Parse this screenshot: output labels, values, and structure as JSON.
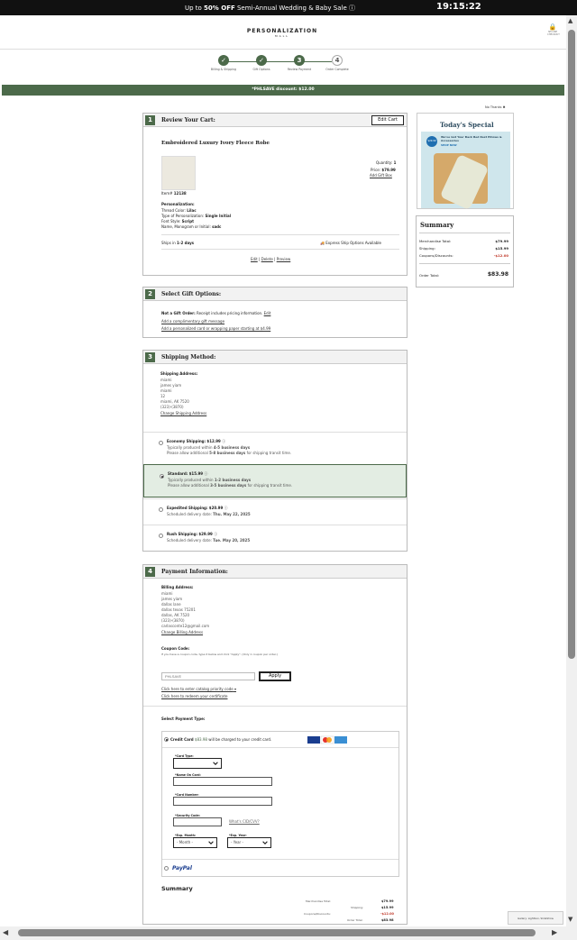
{
  "topbar": {
    "promo_prefix": "Up to ",
    "promo_bold": "50% OFF",
    "promo_suffix": " Semi-Annual Wedding & Baby Sale",
    "clock": "19:15:22"
  },
  "header": {
    "logo_main": "PERSONALIZATION",
    "logo_sub": "MALL",
    "secure_label": "SECURE CHECKOUT"
  },
  "steps": [
    {
      "num": "✓",
      "label": "Billing & Shipping"
    },
    {
      "num": "✓",
      "label": "Gift Options"
    },
    {
      "num": "3",
      "label": "Review Payment"
    },
    {
      "num": "4",
      "label": "Order Complete"
    }
  ],
  "discount_bar": "*PHLSAVE discount: $12.00",
  "no_thanks": "No Thanks",
  "cart": {
    "num": "1",
    "title": "Review Your Cart:",
    "edit_label": "Edit Cart",
    "product_name": "Embroidered Luxury Ivory Fleece Robe",
    "quantity_label": "Quantity:",
    "quantity": "1",
    "price_label": "Price:",
    "price": "$79.99",
    "add_gift_box": "Add Gift Box",
    "item_label": "Item#",
    "item_num": "12138",
    "personalization_title": "Personalization:",
    "pers_rows": [
      {
        "label": "Thread Color:",
        "value": "Lilac"
      },
      {
        "label": "Type of Personalization:",
        "value": "Single Initial"
      },
      {
        "label": "Font Style:",
        "value": "Script"
      },
      {
        "label": "Name, Monogram or Initial:",
        "value": "sadc"
      }
    ],
    "ships_label": "Ships in",
    "ships_value": "1-2 days",
    "express_label": "Express Ship Options Available",
    "actions": [
      "Edit",
      "Delete",
      "Preview"
    ]
  },
  "gift": {
    "num": "2",
    "title": "Select Gift Options:",
    "not_gift_bold": "Not a Gift Order:",
    "not_gift_text": " Receipt includes pricing information.",
    "edit": "Edit",
    "link1": "Add a complimentary gift message",
    "link2": "Add a personalized card or wrapping paper starting at $4.99"
  },
  "shipping": {
    "num": "3",
    "title": "Shipping Method:",
    "addr_title": "Shipping Address:",
    "addr_lines": [
      "miami",
      "james yiam",
      "miami",
      "12",
      "miami, AK 7520",
      "(323)-(3870)"
    ],
    "change_link": "Change Shipping Address",
    "options": [
      {
        "name": "Economy Shipping:",
        "price": "$12.99",
        "line1_pre": "Typically produced within ",
        "line1_b": "4-5 business days",
        "line2_pre": "Please allow additional ",
        "line2_b": "5-8 business days",
        "line2_post": " for shipping transit time."
      },
      {
        "name": "Standard:",
        "price": "$15.99",
        "line1_pre": "Typically produced within ",
        "line1_b": "1-2 business days",
        "line2_pre": "Please allow additional ",
        "line2_b": "3-5 business days",
        "line2_post": " for shipping transit time."
      },
      {
        "name": "Expedited Shipping:",
        "price": "$20.99",
        "line1_pre": "Scheduled delivery date: ",
        "line1_b": "Thu. May 22, 2025"
      },
      {
        "name": "Rush Shipping:",
        "price": "$29.99",
        "line1_pre": "Scheduled delivery date: ",
        "line1_b": "Tue. May 20, 2025"
      }
    ]
  },
  "payment": {
    "num": "4",
    "title": "Payment Information:",
    "addr_title": "Billing Address:",
    "addr_lines": [
      "miami",
      "james yiam",
      "dallas lane",
      "dallas texas 75201",
      "dallas, AK 7520",
      "(323)-(3870)",
      "carlasconte12@gmail.com"
    ],
    "change_link": "Change Billing Address",
    "coupon_title": "Coupon Code:",
    "coupon_help": "If you have a coupon code, type it below and click \"Apply\". (Only 1 coupon per order.)",
    "coupon_placeholder": "PHLSAVE",
    "apply_label": "Apply",
    "link_catalog": "Click here to enter catalog priority code",
    "link_certificate": "Click here to redeem your certificate",
    "select_title": "Select Payment Type:",
    "cc_label": "Credit Card",
    "cc_amount": "$83.98",
    "cc_text": " will be charged to your credit card.",
    "card_type": "*Card Type:",
    "name_on_card": "*Name On Card:",
    "card_number": "*Card Number:",
    "security_code": "*Security Code:",
    "whats_this": "What's CID/CVV?",
    "exp_month": "*Exp. Month:",
    "exp_month_value": "- Month -",
    "exp_year": "*Exp. Year:",
    "exp_year_value": "- Year -",
    "paypal": "PayPal",
    "summary_title": "Summary",
    "summary_rows": [
      {
        "label": "Merchandise Total:",
        "value": "$79.99"
      },
      {
        "label": "Shipping:",
        "value": "$15.99"
      },
      {
        "label": "Coupons/Discounts:",
        "value": "-$12.00"
      },
      {
        "label": "Order Total:",
        "value": "$83.98"
      }
    ]
  },
  "special": {
    "title": "Today's Special",
    "text": "We've Got Your Back Bed Rest Pillows & Accessories",
    "price": "$29.99",
    "shop": "SHOP NOW"
  },
  "summary": {
    "title": "Summary",
    "rows": [
      {
        "label": "Merchandise Total:",
        "value": "$79.99"
      },
      {
        "label": "Shipping:",
        "value": "$15.99"
      },
      {
        "label": "Coupons/Discounts:",
        "value": "-$12.00"
      }
    ],
    "total_label": "Order Total:",
    "total_value": "$83.98"
  },
  "tooltip": "Gallery: Lightbox, SlideShow",
  "colors": {
    "brand_green": "#4c6a4a",
    "discount_red": "#c0392b"
  }
}
